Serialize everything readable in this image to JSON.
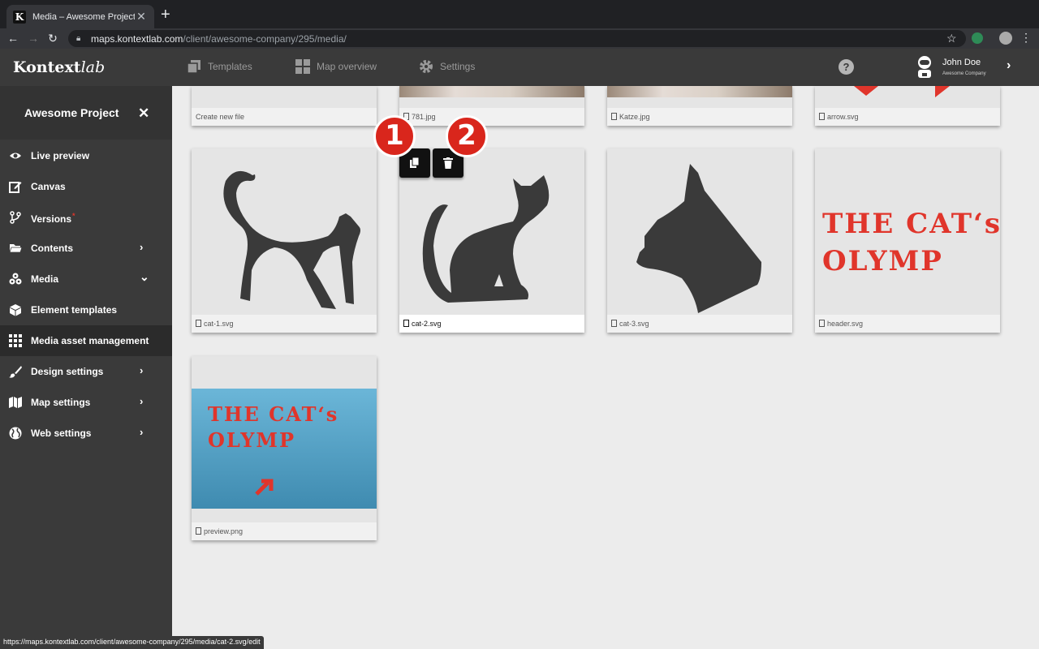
{
  "browser": {
    "tab_title": "Media – Awesome Project",
    "tab_favicon": "K",
    "url_host": "maps.kontextlab.com",
    "url_path": "/client/awesome-company/295/media/"
  },
  "header": {
    "logo_main": "Kontext",
    "logo_accent": "lab",
    "nav": [
      {
        "label": "Templates",
        "icon": "templates-icon"
      },
      {
        "label": "Map overview",
        "icon": "grid-icon"
      },
      {
        "label": "Settings",
        "icon": "gear-icon"
      }
    ],
    "user_name": "John Doe",
    "user_company": "Awesome Company"
  },
  "sidebar": {
    "project_title": "Awesome Project",
    "items": [
      {
        "label": "Live preview",
        "icon": "eye-icon"
      },
      {
        "label": "Canvas",
        "icon": "edit-icon"
      },
      {
        "label": "Versions",
        "icon": "branch-icon",
        "dot": "*"
      },
      {
        "label": "Contents",
        "icon": "folder-icon",
        "chevron": "›"
      },
      {
        "label": "Media",
        "icon": "media-icon",
        "chevron": "⌄"
      },
      {
        "label": "Element templates",
        "icon": "cube-icon"
      },
      {
        "label": "Media asset management",
        "icon": "apps-grid-icon"
      },
      {
        "label": "Design settings",
        "icon": "brush-icon",
        "chevron": "›"
      },
      {
        "label": "Map settings",
        "icon": "map-icon",
        "chevron": "›"
      },
      {
        "label": "Web settings",
        "icon": "globe-icon",
        "chevron": "›"
      }
    ]
  },
  "media": {
    "files": [
      {
        "name": "Create new file"
      },
      {
        "name": "781.jpg"
      },
      {
        "name": "Katze.jpg"
      },
      {
        "name": "arrow.svg"
      },
      {
        "name": "cat-1.svg"
      },
      {
        "name": "cat-2.svg"
      },
      {
        "name": "cat-3.svg"
      },
      {
        "name": "header.svg"
      },
      {
        "name": "preview.png"
      }
    ],
    "header_art_line1": "THE CAT‘s",
    "header_art_line2": "OLYMP",
    "badge_1": "1",
    "badge_2": "2"
  },
  "status_url": "https://maps.kontextlab.com/client/awesome-company/295/media/cat-2.svg/edit"
}
